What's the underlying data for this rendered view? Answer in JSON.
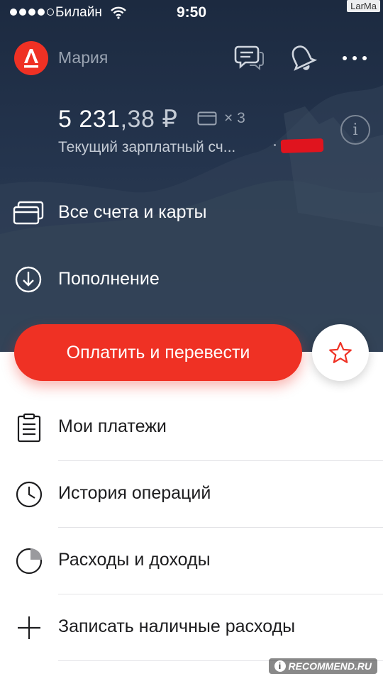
{
  "status_bar": {
    "carrier": "Билайн",
    "time": "9:50",
    "watermark": "LarMa"
  },
  "header": {
    "bank_logo_letter": "А",
    "user_name": "Мария",
    "icons": [
      "chat-icon",
      "bell-icon",
      "more-icon"
    ]
  },
  "account": {
    "balance_main": "5 231",
    "balance_kop": ",38",
    "currency": "₽",
    "card_count": "× 3",
    "name": "Текущий зарплатный сч...",
    "info_glyph": "i"
  },
  "hero_menu": [
    {
      "label": "Все счета и карты",
      "icon": "cards-icon"
    },
    {
      "label": "Пополнение",
      "icon": "download-circle-icon"
    }
  ],
  "actions": {
    "pay_label": "Оплатить и перевести",
    "favorites_icon": "star-icon"
  },
  "menu": [
    {
      "label": "Мои платежи",
      "icon": "clipboard-icon"
    },
    {
      "label": "История операций",
      "icon": "clock-icon"
    },
    {
      "label": "Расходы и доходы",
      "icon": "pie-chart-icon"
    },
    {
      "label": "Записать наличные расходы",
      "icon": "plus-icon"
    }
  ],
  "footer": {
    "watermark": "RECOMMEND.RU"
  },
  "colors": {
    "brand_red": "#ef3124",
    "hero_bg": "#24344d",
    "text_dark": "#1d1d1f"
  }
}
